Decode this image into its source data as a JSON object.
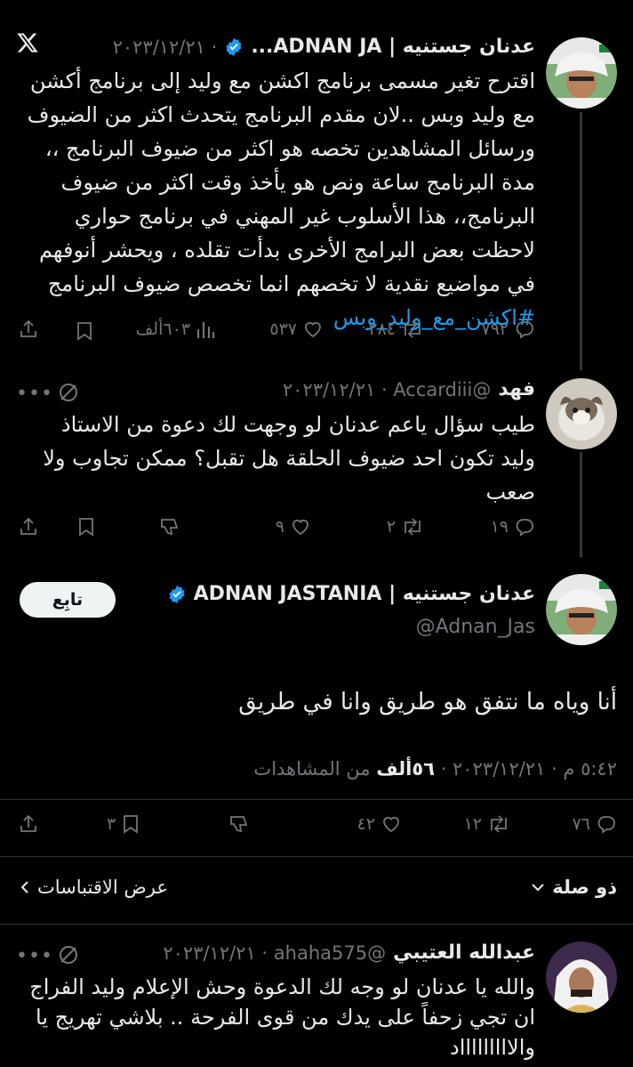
{
  "tweet1": {
    "name": "عدنان جستنيه | ADNAN JA...",
    "date": "· ٢٠٢٣/١٢/٢١",
    "lines": [
      "اقترح تغير مسمى برنامج اكشن مع وليد إلى برنامج أكشن",
      "مع وليد وبس ..لان مقدم البرنامج يتحدث اكثر من الضيوف",
      "ورسائل المشاهدين تخصه هو اكثر من ضيوف البرنامج ،،",
      "مدة البرنامج  ساعة ونص هو يأخذ وقت اكثر من ضيوف",
      "البرنامج،، هذا الأسلوب غير المهني في برنامج حواري",
      "لاحظت بعض البرامج الأخرى بدأت تقلده ، ويحشر أنوفهم",
      "في مواضيع نقدية لا تخصهم انما تخصص ضيوف البرنامج"
    ],
    "hashtag": "#اكشن_مع_وليد_وبس",
    "replies": "٧٩٢",
    "retweets": "٢٨٤",
    "likes": "٥٣٧",
    "views": "٦٠٣ألف"
  },
  "tweet2": {
    "name": "فهد",
    "handle_date": "@Accardiii · ٢٠٢٣/١٢/٢١",
    "lines": [
      "طيب سؤال ياعم عدنان لو وجهت لك دعوة من الاستاذ",
      "وليد تكون احد ضيوف الحلقة هل تقبل؟ ممكن تجاوب ولا",
      "صعب"
    ],
    "replies": "١٩",
    "retweets": "٢",
    "likes": "٩"
  },
  "main": {
    "name": "عدنان جستنيه | ADNAN JASTANIA",
    "handle": "@Adnan_Jas",
    "follow_label": "تابِع",
    "text": "أنا وياه ما نتفق هو طريق وانا في طريق",
    "timestamp": "٥:٤٢ م · ٢٠٢٣/١٢/٢١ · ",
    "views_count": "٥٦ألف",
    "views_label": " من المشاهدات",
    "replies": "٧٦",
    "retweets": "١٢",
    "likes": "٤٢",
    "bookmarks": "٣"
  },
  "controls": {
    "relevance": "ذو صلة",
    "quotes": "عرض الاقتباسات"
  },
  "tweet3": {
    "name": "عبدالله العتيبي",
    "handle_date": "@ahaha575 · ٢٠٢٣/١٢/٢١",
    "lines": [
      "والله يا عدنان لو وجه لك الدعوة وحش الإعلام وليد الفراج",
      "ان تجي زحفاً على يدك من قوى الفرحة .. بلاشي تهريج يا",
      "والاااااااااد"
    ]
  },
  "colors": {
    "accent": "#1d9bf0",
    "muted": "#71767b",
    "text": "#e7e9ea",
    "background": "#000000"
  }
}
